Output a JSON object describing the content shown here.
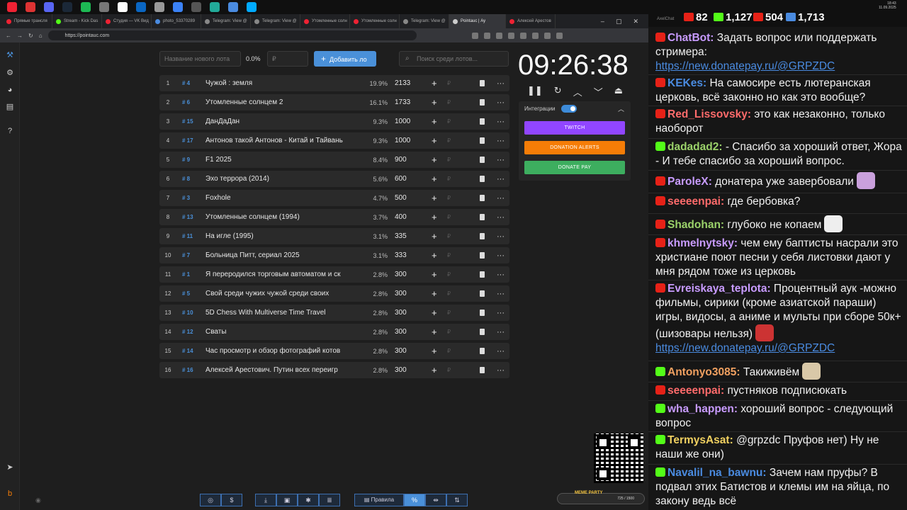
{
  "os": {
    "time": "18:43",
    "date": "11.09.2025",
    "lang": "РУС"
  },
  "browser": {
    "tabs": [
      {
        "label": "Прямые трансля",
        "color": "#e23"
      },
      {
        "label": "Stream - Kick Das",
        "color": "#53fc18"
      },
      {
        "label": "Студия — VK Вид",
        "color": "#e23"
      },
      {
        "label": "photo_53370289",
        "color": "#4a8be0"
      },
      {
        "label": "Telegram: View @",
        "color": "#888"
      },
      {
        "label": "Telegram: View @",
        "color": "#888"
      },
      {
        "label": "Утомленные солн",
        "color": "#e23"
      },
      {
        "label": "Утомленные солн",
        "color": "#e23"
      },
      {
        "label": "Telegram: View @",
        "color": "#888"
      },
      {
        "label": "Pointauc | Ау",
        "color": "#ccc"
      },
      {
        "label": "Алексей Арестов",
        "color": "#e23"
      }
    ],
    "url": "https://pointauc.com"
  },
  "app": {
    "new_lot_placeholder": "Название нового лота",
    "percent_value": "0.0%",
    "amount_placeholder": "₽",
    "add_button": "Добавить ло",
    "search_placeholder": "Поиск среди лотов...",
    "timer": "09:26:38",
    "integrations_label": "Интеграции",
    "twitch_label": "TWITCH",
    "donation_alerts_label": "DONATION ALERTS",
    "donate_pay_label": "DONATE PAY",
    "rub_symbol": "₽",
    "more_symbol": "···",
    "plus_symbol": "+",
    "meme_label": "MEME PARTY",
    "meme_count": "725 / 1500",
    "rules_label": "Правила",
    "lots": [
      {
        "num": "1",
        "id": "# 4",
        "name": "Чужой : земля",
        "pct": "19.9%",
        "amount": "2133"
      },
      {
        "num": "2",
        "id": "# 6",
        "name": "Утомленные солнцем 2",
        "pct": "16.1%",
        "amount": "1733"
      },
      {
        "num": "3",
        "id": "# 15",
        "name": "ДанДаДан",
        "pct": "9.3%",
        "amount": "1000"
      },
      {
        "num": "4",
        "id": "# 17",
        "name": "Антонов такой Антонов - Китай и Тайвань",
        "pct": "9.3%",
        "amount": "1000"
      },
      {
        "num": "5",
        "id": "# 9",
        "name": "F1 2025",
        "pct": "8.4%",
        "amount": "900"
      },
      {
        "num": "6",
        "id": "# 8",
        "name": "Эхо террора (2014)",
        "pct": "5.6%",
        "amount": "600"
      },
      {
        "num": "7",
        "id": "# 3",
        "name": "Foxhole",
        "pct": "4.7%",
        "amount": "500"
      },
      {
        "num": "8",
        "id": "# 13",
        "name": "Утомленные солнцем (1994)",
        "pct": "3.7%",
        "amount": "400"
      },
      {
        "num": "9",
        "id": "# 11",
        "name": "На игле (1995)",
        "pct": "3.1%",
        "amount": "335"
      },
      {
        "num": "10",
        "id": "# 7",
        "name": "Больница Питт, сериал 2025",
        "pct": "3.1%",
        "amount": "333"
      },
      {
        "num": "11",
        "id": "# 1",
        "name": "Я переродился торговым автоматом и ск",
        "pct": "2.8%",
        "amount": "300"
      },
      {
        "num": "12",
        "id": "# 5",
        "name": "Свой среди чужих чужой среди своих",
        "pct": "2.8%",
        "amount": "300"
      },
      {
        "num": "13",
        "id": "# 10",
        "name": "5D Chess With Multiverse Time Travel",
        "pct": "2.8%",
        "amount": "300"
      },
      {
        "num": "14",
        "id": "# 12",
        "name": "Сваты",
        "pct": "2.8%",
        "amount": "300"
      },
      {
        "num": "15",
        "id": "# 14",
        "name": "Час просмотр и обзор фотографий котов",
        "pct": "2.8%",
        "amount": "300"
      },
      {
        "num": "16",
        "id": "# 16",
        "name": "Алексей Арестович. Путин всех переигр",
        "pct": "2.8%",
        "amount": "300"
      }
    ]
  },
  "chat": {
    "title": "AxelChat",
    "stats": [
      {
        "value": "82",
        "color": "#e62117"
      },
      {
        "value": "1,127",
        "color": "#53fc18"
      },
      {
        "value": "504",
        "color": "#e62117"
      },
      {
        "value": "1,713",
        "color": "#4a8be0"
      }
    ],
    "messages": [
      {
        "user": "ChatBot:",
        "user_color": "#c89bff",
        "badge": "#e62117",
        "text": "Задать вопрос или поддержать стримера:",
        "link": "https://new.donatepay.ru/@GRPZDC"
      },
      {
        "user": "KEKes:",
        "user_color": "#4a8be0",
        "badge": "#e62117",
        "text": "На самосире есть лютеранская церковь, всё законно но как это вообще?"
      },
      {
        "user": "Red_Lissovsky:",
        "user_color": "#ff6b6b",
        "badge": "#e62117",
        "text": "это как незаконно, только наоборот"
      },
      {
        "user": "dadadad2:",
        "user_color": "#9bd26a",
        "badge": "#53fc18",
        "text": "- Спасибо за хороший ответ, Жора - И тебе спасибо за хороший вопрос."
      },
      {
        "user": "ParoleX:",
        "user_color": "#c89bff",
        "badge": "#e62117",
        "text": "донатера уже завербовали"
      },
      {
        "user": "seeeenpai:",
        "user_color": "#ff6b6b",
        "badge": "#e62117",
        "text": "где бербовка?"
      },
      {
        "user": "Shadohan:",
        "user_color": "#9bd26a",
        "badge": "#e62117",
        "text": "глубоко не копаем"
      },
      {
        "user": "khmelnytsky:",
        "user_color": "#c89bff",
        "badge": "#e62117",
        "text": "чем ему баптисты насрали это христиане поют песни у себя листовки дают у мня рядом тоже из церковь"
      },
      {
        "user": "Evreiskaya_teplota:",
        "user_color": "#c89bff",
        "badge": "#e62117",
        "text": "Процентный аук -можно фильмы, сирики (кроме азиатской параши) игры, видосы, а аниме и мульты при сборе 50к+ (шизовары нельзя)",
        "link": "https://new.donatepay.ru/@GRPZDC"
      },
      {
        "user": "Antonyo3085:",
        "user_color": "#f0a060",
        "badge": "#53fc18",
        "text": "Такиживём"
      },
      {
        "user": "seeeenpai:",
        "user_color": "#ff6b6b",
        "badge": "#e62117",
        "text": "пустняков подписюкать"
      },
      {
        "user": "wha_happen:",
        "user_color": "#c89bff",
        "badge": "#53fc18",
        "text": "хороший вопрос - следующий вопрос"
      },
      {
        "user": "TermysAsat:",
        "user_color": "#f0d060",
        "badge": "#53fc18",
        "text": "@grpzdc Пруфов нет) Ну не наши же они)"
      },
      {
        "user": "Navalil_na_bawnu:",
        "user_color": "#4a8be0",
        "badge": "#53fc18",
        "text": "Зачем нам пруфы? В подвал этих Батистов и клемы им на яйца, по закону ведь всё"
      }
    ]
  },
  "colors": {
    "accent": "#4a90d9",
    "twitch": "#9146ff",
    "donation_alerts": "#f57d07",
    "donate_pay": "#3dae5f"
  }
}
